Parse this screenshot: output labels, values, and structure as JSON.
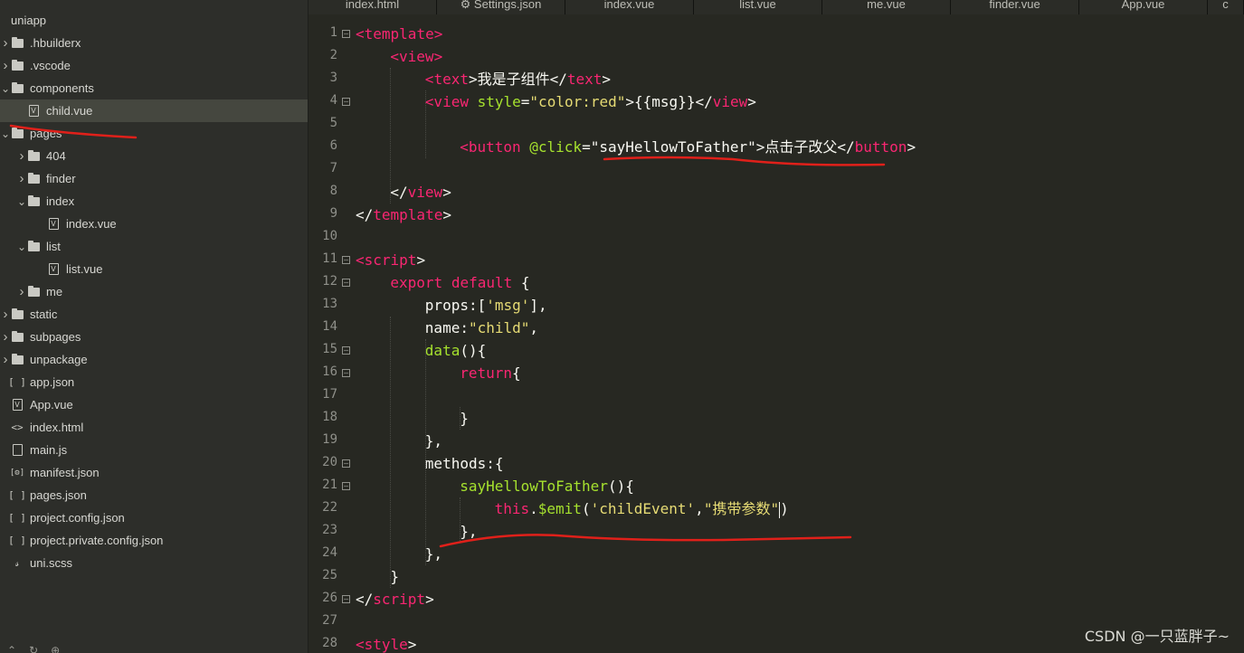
{
  "tabs": [
    {
      "label": "index.html",
      "icon": ""
    },
    {
      "label": "Settings.json",
      "icon": "gear-icon"
    },
    {
      "label": "index.vue",
      "icon": ""
    },
    {
      "label": "list.vue",
      "icon": ""
    },
    {
      "label": "me.vue",
      "icon": ""
    },
    {
      "label": "finder.vue",
      "icon": ""
    },
    {
      "label": "App.vue",
      "icon": ""
    },
    {
      "label": "c",
      "icon": ""
    }
  ],
  "tree": [
    {
      "label": "uniapp",
      "depth": 0,
      "arrow": "",
      "icon": "none",
      "selected": false
    },
    {
      "label": ".hbuilderx",
      "depth": 0,
      "arrow": "right",
      "icon": "folder-icon",
      "selected": false
    },
    {
      "label": ".vscode",
      "depth": 0,
      "arrow": "right",
      "icon": "folder-icon",
      "selected": false
    },
    {
      "label": "components",
      "depth": 0,
      "arrow": "down",
      "icon": "folder-icon",
      "selected": false
    },
    {
      "label": "child.vue",
      "depth": 1,
      "arrow": "",
      "icon": "vue-file-icon",
      "selected": true
    },
    {
      "label": "pages",
      "depth": 0,
      "arrow": "down",
      "icon": "folder-icon",
      "selected": false
    },
    {
      "label": "404",
      "depth": 1,
      "arrow": "right",
      "icon": "folder-icon",
      "selected": false
    },
    {
      "label": "finder",
      "depth": 1,
      "arrow": "right",
      "icon": "folder-icon",
      "selected": false
    },
    {
      "label": "index",
      "depth": 1,
      "arrow": "down",
      "icon": "folder-icon",
      "selected": false
    },
    {
      "label": "index.vue",
      "depth": 2,
      "arrow": "",
      "icon": "vue-file-icon",
      "selected": false
    },
    {
      "label": "list",
      "depth": 1,
      "arrow": "down",
      "icon": "folder-icon",
      "selected": false
    },
    {
      "label": "list.vue",
      "depth": 2,
      "arrow": "",
      "icon": "vue-file-icon",
      "selected": false
    },
    {
      "label": "me",
      "depth": 1,
      "arrow": "right",
      "icon": "folder-icon",
      "selected": false
    },
    {
      "label": "static",
      "depth": 0,
      "arrow": "right",
      "icon": "folder-icon",
      "selected": false
    },
    {
      "label": "subpages",
      "depth": 0,
      "arrow": "right",
      "icon": "folder-icon",
      "selected": false
    },
    {
      "label": "unpackage",
      "depth": 0,
      "arrow": "right",
      "icon": "folder-icon",
      "selected": false
    },
    {
      "label": "app.json",
      "depth": 0,
      "arrow": "",
      "icon": "json-file-icon",
      "selected": false
    },
    {
      "label": "App.vue",
      "depth": 0,
      "arrow": "",
      "icon": "vue-file-icon",
      "selected": false
    },
    {
      "label": "index.html",
      "depth": 0,
      "arrow": "",
      "icon": "html-file-icon",
      "selected": false
    },
    {
      "label": "main.js",
      "depth": 0,
      "arrow": "",
      "icon": "js-file-icon",
      "selected": false
    },
    {
      "label": "manifest.json",
      "depth": 0,
      "arrow": "",
      "icon": "manifest-file-icon",
      "selected": false
    },
    {
      "label": "pages.json",
      "depth": 0,
      "arrow": "",
      "icon": "json-file-icon",
      "selected": false
    },
    {
      "label": "project.config.json",
      "depth": 0,
      "arrow": "",
      "icon": "json-file-icon",
      "selected": false
    },
    {
      "label": "project.private.config.json",
      "depth": 0,
      "arrow": "",
      "icon": "json-file-icon",
      "selected": false
    },
    {
      "label": "uni.scss",
      "depth": 0,
      "arrow": "",
      "icon": "scss-file-icon",
      "selected": false
    }
  ],
  "editor": {
    "lines": [
      {
        "n": "1",
        "fold": true,
        "indent": 0,
        "tokens": [
          [
            "tag",
            "<"
          ],
          [
            "tag",
            "template"
          ],
          [
            "tag",
            ">"
          ]
        ]
      },
      {
        "n": "2",
        "fold": false,
        "indent": 1,
        "tokens": [
          [
            "tag",
            "<"
          ],
          [
            "tag",
            "view"
          ],
          [
            "tag",
            ">"
          ]
        ]
      },
      {
        "n": "3",
        "fold": false,
        "indent": 2,
        "tokens": [
          [
            "tag",
            "<"
          ],
          [
            "tag",
            "text"
          ],
          [
            "plain",
            ">我是子组件</"
          ],
          [
            "tag",
            "text"
          ],
          [
            "plain",
            ">"
          ]
        ]
      },
      {
        "n": "4",
        "fold": true,
        "indent": 2,
        "tokens": [
          [
            "tag",
            "<view"
          ],
          [
            "plain",
            " "
          ],
          [
            "attr",
            "style"
          ],
          [
            "plain",
            "="
          ],
          [
            "str",
            "\"color:red\""
          ],
          [
            "plain",
            ">{{msg}}</"
          ],
          [
            "tag",
            "view"
          ],
          [
            "plain",
            ">"
          ]
        ]
      },
      {
        "n": "5",
        "fold": false,
        "indent": 0,
        "tokens": []
      },
      {
        "n": "6",
        "fold": false,
        "indent": 3,
        "tokens": [
          [
            "tag",
            "<button"
          ],
          [
            "plain",
            " "
          ],
          [
            "attr",
            "@click"
          ],
          [
            "plain",
            "=\""
          ],
          [
            "plain",
            "sayHellowToFather"
          ],
          [
            "plain",
            "\">点击子改父</"
          ],
          [
            "tag",
            "button"
          ],
          [
            "plain",
            ">"
          ]
        ]
      },
      {
        "n": "7",
        "fold": false,
        "indent": 0,
        "tokens": []
      },
      {
        "n": "8",
        "fold": false,
        "indent": 1,
        "tokens": [
          [
            "plain",
            "</"
          ],
          [
            "tag",
            "view"
          ],
          [
            "plain",
            ">"
          ]
        ]
      },
      {
        "n": "9",
        "fold": false,
        "indent": 0,
        "tokens": [
          [
            "plain",
            "</"
          ],
          [
            "tag",
            "template"
          ],
          [
            "plain",
            ">"
          ]
        ]
      },
      {
        "n": "10",
        "fold": false,
        "indent": 0,
        "tokens": []
      },
      {
        "n": "11",
        "fold": true,
        "indent": 0,
        "tokens": [
          [
            "tag",
            "<script"
          ],
          [
            "plain",
            ">"
          ]
        ]
      },
      {
        "n": "12",
        "fold": true,
        "indent": 1,
        "tokens": [
          [
            "kw",
            "export"
          ],
          [
            "plain",
            " "
          ],
          [
            "kw",
            "default"
          ],
          [
            "plain",
            " {"
          ]
        ]
      },
      {
        "n": "13",
        "fold": false,
        "indent": 2,
        "tokens": [
          [
            "plain",
            "props:["
          ],
          [
            "str",
            "'msg'"
          ],
          [
            "plain",
            "],"
          ]
        ]
      },
      {
        "n": "14",
        "fold": false,
        "indent": 2,
        "tokens": [
          [
            "plain",
            "name:"
          ],
          [
            "str",
            "\"child\""
          ],
          [
            "plain",
            ","
          ]
        ]
      },
      {
        "n": "15",
        "fold": true,
        "indent": 2,
        "tokens": [
          [
            "fn",
            "data"
          ],
          [
            "plain",
            "(){"
          ]
        ]
      },
      {
        "n": "16",
        "fold": true,
        "indent": 3,
        "tokens": [
          [
            "kw",
            "return"
          ],
          [
            "plain",
            "{"
          ]
        ]
      },
      {
        "n": "17",
        "fold": false,
        "indent": 0,
        "tokens": []
      },
      {
        "n": "18",
        "fold": false,
        "indent": 3,
        "tokens": [
          [
            "plain",
            "}"
          ]
        ]
      },
      {
        "n": "19",
        "fold": false,
        "indent": 2,
        "tokens": [
          [
            "plain",
            "},"
          ]
        ]
      },
      {
        "n": "20",
        "fold": true,
        "indent": 2,
        "tokens": [
          [
            "plain",
            "methods:{"
          ]
        ]
      },
      {
        "n": "21",
        "fold": true,
        "indent": 3,
        "tokens": [
          [
            "fn",
            "sayHellowToFather"
          ],
          [
            "plain",
            "(){"
          ]
        ]
      },
      {
        "n": "22",
        "fold": false,
        "indent": 4,
        "tokens": [
          [
            "kw",
            "this"
          ],
          [
            "plain",
            "."
          ],
          [
            "fn",
            "$emit"
          ],
          [
            "plain",
            "("
          ],
          [
            "str",
            "'childEvent'"
          ],
          [
            "plain",
            ","
          ],
          [
            "str",
            "\"携带参数\""
          ],
          [
            "cursor",
            ""
          ],
          [
            "plain",
            ")"
          ]
        ]
      },
      {
        "n": "23",
        "fold": false,
        "indent": 3,
        "tokens": [
          [
            "plain",
            "},"
          ]
        ]
      },
      {
        "n": "24",
        "fold": false,
        "indent": 2,
        "tokens": [
          [
            "plain",
            "},"
          ]
        ]
      },
      {
        "n": "25",
        "fold": false,
        "indent": 1,
        "tokens": [
          [
            "plain",
            "}"
          ]
        ]
      },
      {
        "n": "26",
        "fold": true,
        "indent": 0,
        "tokens": [
          [
            "plain",
            "</"
          ],
          [
            "tag",
            "script"
          ],
          [
            "plain",
            ">"
          ]
        ]
      },
      {
        "n": "27",
        "fold": false,
        "indent": 0,
        "tokens": []
      },
      {
        "n": "28",
        "fold": false,
        "indent": 0,
        "tokens": [
          [
            "tag",
            "<style"
          ],
          [
            "plain",
            ">"
          ]
        ]
      }
    ]
  },
  "annotation_color": "#e0201a",
  "watermark": "CSDN @一只蓝胖子~"
}
